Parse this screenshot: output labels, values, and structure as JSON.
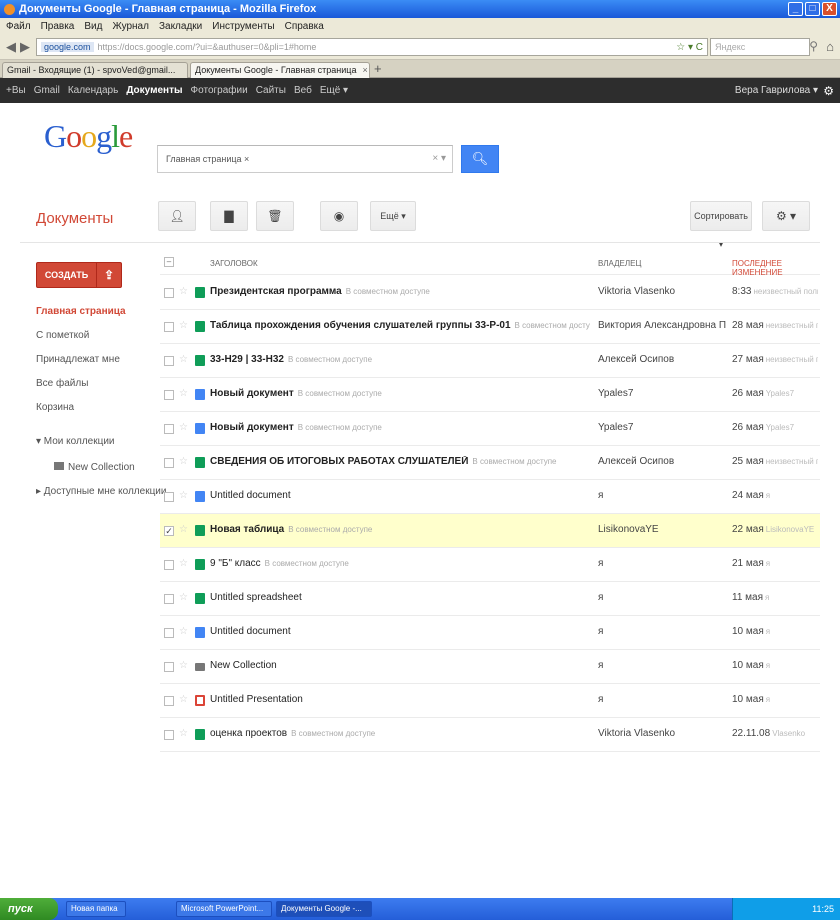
{
  "window": {
    "title": "Документы Google - Главная страница - Mozilla Firefox",
    "buttons": [
      "_",
      "□",
      "X"
    ]
  },
  "menubar": [
    "Файл",
    "Правка",
    "Вид",
    "Журнал",
    "Закладки",
    "Инструменты",
    "Справка"
  ],
  "navbar": {
    "domain": "google.com",
    "url": "https://docs.google.com/?ui=&authuser=0&pli=1#home",
    "search_placeholder": "Яндекс"
  },
  "tabs": [
    {
      "label": "Gmail - Входящие (1) - spvoVed@gmail..."
    },
    {
      "label": "Документы Google - Главная страница"
    }
  ],
  "gbar": {
    "items": [
      "+Вы",
      "Gmail",
      "Календарь",
      "Документы",
      "Фотографии",
      "Сайты",
      "Веб",
      "Ещё ▾"
    ],
    "active": "Документы",
    "user": "Вера Гаврилова ▾"
  },
  "logo": [
    "G",
    "o",
    "o",
    "g",
    "l",
    "e"
  ],
  "search": {
    "chip": "Главная страница ×",
    "button_icon": "search-icon"
  },
  "docs_title": "Документы",
  "toolbar": {
    "more": "Ещё ▾",
    "sort": "Сортировать ▾",
    "settings": "⚙ ▾"
  },
  "sidebar": {
    "create": "СОЗДАТЬ",
    "items": [
      "Главная страница",
      "С пометкой",
      "Принадлежат мне",
      "Все файлы",
      "Корзина",
      "▾ Мои коллекции",
      "New Collection",
      "▸ Доступные мне коллекции"
    ]
  },
  "list": {
    "headers": {
      "title": "ЗАГОЛОВОК",
      "owner": "ВЛАДЕЛЕЦ",
      "modified": "ПОСЛЕДНЕЕ ИЗМЕНЕНИЕ"
    },
    "rows": [
      {
        "type": "sheet",
        "title": "Президентская программа",
        "bold": true,
        "shared": "В совместном доступе",
        "owner": "Viktoria Vlasenko",
        "date": "8:33",
        "by": "неизвестный пользователь",
        "checked": false
      },
      {
        "type": "sheet",
        "title": "Таблица прохождения обучения слушателей группы 33-Р-01",
        "bold": true,
        "shared": "В совместном доступе",
        "owner": "Виктория Александровна П",
        "date": "28 мая",
        "by": "неизвестный пользователь",
        "checked": false
      },
      {
        "type": "sheet",
        "title": "33-Н29 | 33-Н32",
        "bold": true,
        "shared": "В совместном доступе",
        "owner": "Алексей Осипов",
        "date": "27 мая",
        "by": "неизвестный пользователь",
        "checked": false
      },
      {
        "type": "doc",
        "title": "Новый документ",
        "bold": true,
        "shared": "В совместном доступе",
        "owner": "Ypales7",
        "date": "26 мая",
        "by": "Ypales7",
        "checked": false
      },
      {
        "type": "doc",
        "title": "Новый документ",
        "bold": true,
        "shared": "В совместном доступе",
        "owner": "Ypales7",
        "date": "26 мая",
        "by": "Ypales7",
        "checked": false
      },
      {
        "type": "sheet",
        "title": "СВЕДЕНИЯ ОБ ИТОГОВЫХ РАБОТАХ СЛУШАТЕЛЕЙ",
        "bold": true,
        "shared": "В совместном доступе",
        "owner": "Алексей Осипов",
        "date": "25 мая",
        "by": "неизвестный пользователь",
        "checked": false
      },
      {
        "type": "doc",
        "title": "Untitled document",
        "bold": false,
        "shared": "",
        "owner": "я",
        "date": "24 мая",
        "by": "я",
        "checked": false
      },
      {
        "type": "sheet",
        "title": "Новая таблица",
        "bold": true,
        "shared": "В совместном доступе",
        "owner": "LisikonovaYE",
        "date": "22 мая",
        "by": "LisikonovaYE",
        "checked": true
      },
      {
        "type": "sheet",
        "title": "9 \"Б\" класс",
        "bold": false,
        "shared": "В совместном доступе",
        "owner": "я",
        "date": "21 мая",
        "by": "я",
        "checked": false
      },
      {
        "type": "sheet",
        "title": "Untitled spreadsheet",
        "bold": false,
        "shared": "",
        "owner": "я",
        "date": "11 мая",
        "by": "я",
        "checked": false
      },
      {
        "type": "doc",
        "title": "Untitled document",
        "bold": false,
        "shared": "",
        "owner": "я",
        "date": "10 мая",
        "by": "я",
        "checked": false
      },
      {
        "type": "folder",
        "title": "New Collection",
        "bold": false,
        "shared": "",
        "owner": "я",
        "date": "10 мая",
        "by": "я",
        "checked": false
      },
      {
        "type": "pres",
        "title": "Untitled Presentation",
        "bold": false,
        "shared": "",
        "owner": "я",
        "date": "10 мая",
        "by": "я",
        "checked": false
      },
      {
        "type": "sheet",
        "title": "оценка проектов",
        "bold": false,
        "shared": "В совместном доступе",
        "owner": "Viktoria Vlasenko",
        "date": "22.11.08",
        "by": "Vlasenko",
        "checked": false
      }
    ]
  },
  "taskbar": {
    "start": "пуск",
    "tasks": [
      "Новая папка",
      "Microsoft PowerPoint...",
      "Документы Google -..."
    ],
    "clock": "11:25"
  }
}
